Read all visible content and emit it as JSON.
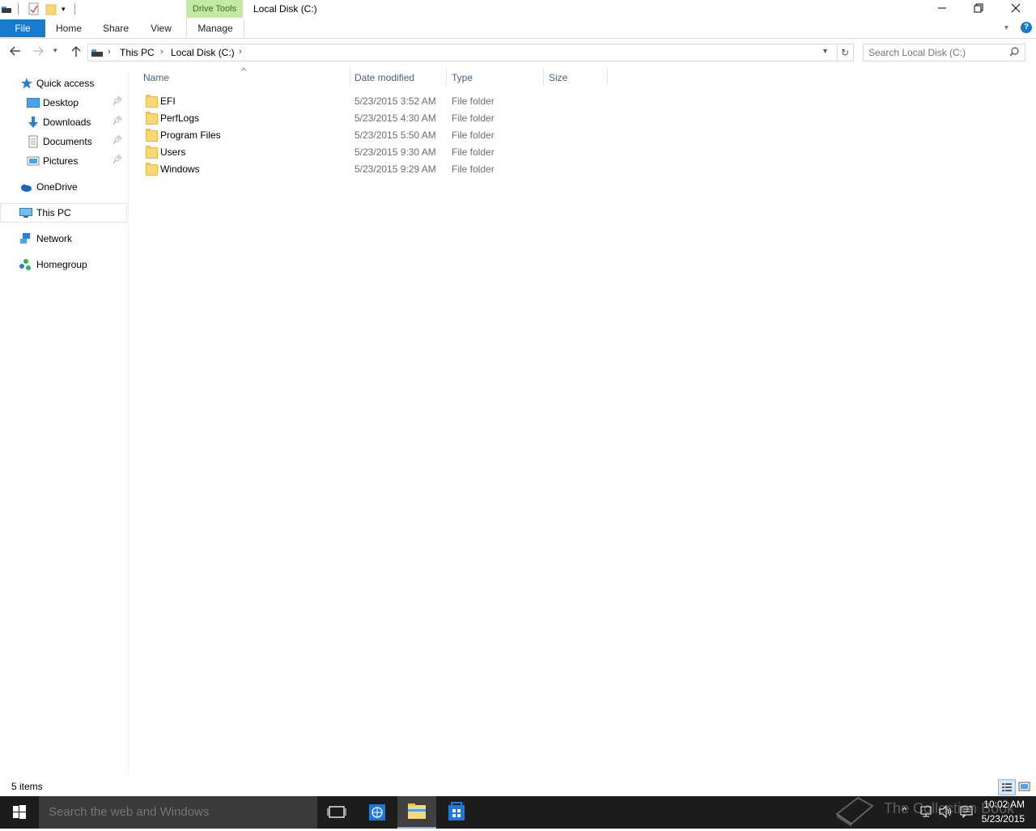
{
  "window": {
    "title": "Local Disk (C:)",
    "context_tab_group": "Drive Tools"
  },
  "ribbon": {
    "tabs": [
      "File",
      "Home",
      "Share",
      "View",
      "Manage"
    ]
  },
  "address": {
    "crumbs": [
      "This PC",
      "Local Disk (C:)"
    ]
  },
  "search": {
    "placeholder": "Search Local Disk (C:)"
  },
  "nav": {
    "quick_access": "Quick access",
    "pinned": [
      "Desktop",
      "Downloads",
      "Documents",
      "Pictures"
    ],
    "onedrive": "OneDrive",
    "thispc": "This PC",
    "network": "Network",
    "homegroup": "Homegroup"
  },
  "columns": {
    "name": "Name",
    "date": "Date modified",
    "type": "Type",
    "size": "Size"
  },
  "files": [
    {
      "name": "EFI",
      "date": "5/23/2015 3:52 AM",
      "type": "File folder"
    },
    {
      "name": "PerfLogs",
      "date": "5/23/2015 4:30 AM",
      "type": "File folder"
    },
    {
      "name": "Program Files",
      "date": "5/23/2015 5:50 AM",
      "type": "File folder"
    },
    {
      "name": "Users",
      "date": "5/23/2015 9:30 AM",
      "type": "File folder"
    },
    {
      "name": "Windows",
      "date": "5/23/2015 9:29 AM",
      "type": "File folder"
    }
  ],
  "status": {
    "item_count": "5 items"
  },
  "taskbar": {
    "search_placeholder": "Search the web and Windows",
    "time": "10:02 AM",
    "date": "5/23/2015",
    "watermark": "The Collection Book"
  },
  "colors": {
    "file_tab": "#1979ca",
    "context_tab": "#c4e8a6",
    "taskbar": "#1c1c1c"
  }
}
